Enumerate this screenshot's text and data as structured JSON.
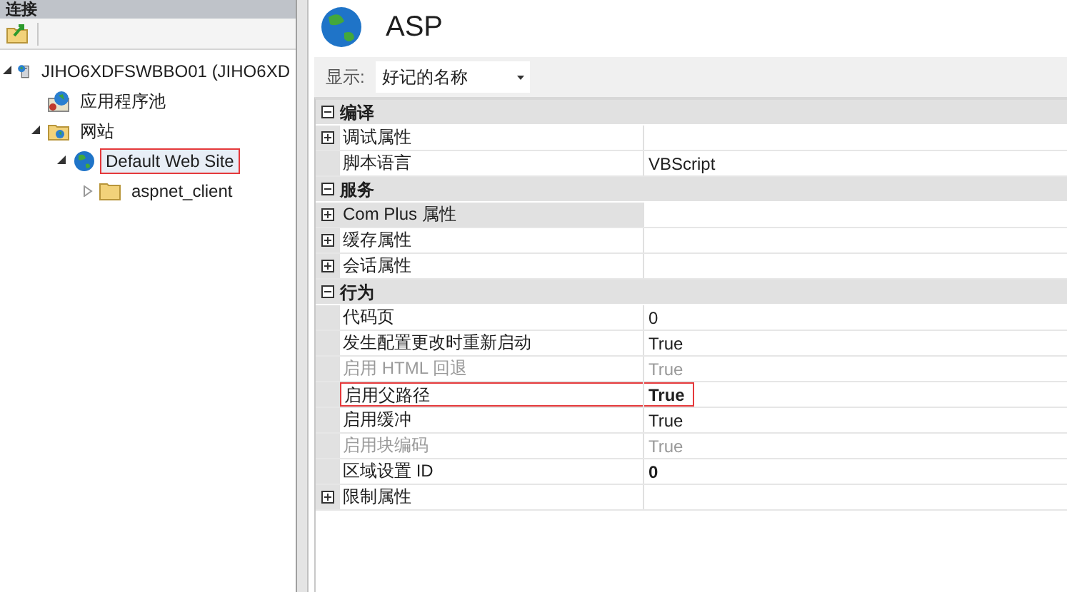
{
  "connections": {
    "title": "连接",
    "tree": [
      {
        "label": "JIHO6XDFSWBBO01 (JIHO6XD",
        "kind": "server",
        "expanded": true,
        "selected": false,
        "children": [
          {
            "label": "应用程序池",
            "kind": "pool",
            "selected": false
          },
          {
            "label": "网站",
            "kind": "sites",
            "expanded": true,
            "selected": false,
            "children": [
              {
                "label": "Default Web Site",
                "kind": "site",
                "expanded": true,
                "selected": true,
                "children": [
                  {
                    "label": "aspnet_client",
                    "kind": "folder",
                    "expanded": false,
                    "selected": false
                  }
                ]
              }
            ]
          }
        ]
      }
    ]
  },
  "header": {
    "title": "ASP"
  },
  "display": {
    "label": "显示:",
    "value": "好记的名称"
  },
  "properties": [
    {
      "kind": "category",
      "name": "编译",
      "expanded": true
    },
    {
      "kind": "property",
      "name": "调试属性",
      "expandable": true,
      "disabled": false,
      "selected": false,
      "highlighted": false
    },
    {
      "kind": "property",
      "name": "脚本语言",
      "value": "VBScript",
      "expandable": false,
      "disabled": false,
      "bold": false,
      "selected": false,
      "highlighted": false
    },
    {
      "kind": "category",
      "name": "服务",
      "expanded": true
    },
    {
      "kind": "property",
      "name": "Com Plus 属性",
      "expandable": true,
      "disabled": false,
      "selected": true,
      "highlighted": false
    },
    {
      "kind": "property",
      "name": "缓存属性",
      "expandable": true,
      "disabled": false,
      "selected": false,
      "highlighted": false
    },
    {
      "kind": "property",
      "name": "会话属性",
      "expandable": true,
      "disabled": false,
      "selected": false,
      "highlighted": false
    },
    {
      "kind": "category",
      "name": "行为",
      "expanded": true
    },
    {
      "kind": "property",
      "name": "代码页",
      "value": "0",
      "expandable": false,
      "disabled": false,
      "bold": false,
      "selected": false,
      "highlighted": false
    },
    {
      "kind": "property",
      "name": "发生配置更改时重新启动",
      "value": "True",
      "expandable": false,
      "disabled": false,
      "bold": false,
      "selected": false,
      "highlighted": false
    },
    {
      "kind": "property",
      "name": "启用 HTML 回退",
      "value": "True",
      "expandable": false,
      "disabled": true,
      "bold": false,
      "selected": false,
      "highlighted": false
    },
    {
      "kind": "property",
      "name": "启用父路径",
      "value": "True",
      "expandable": false,
      "disabled": false,
      "bold": true,
      "selected": false,
      "highlighted": true
    },
    {
      "kind": "property",
      "name": "启用缓冲",
      "value": "True",
      "expandable": false,
      "disabled": false,
      "bold": false,
      "selected": false,
      "highlighted": false
    },
    {
      "kind": "property",
      "name": "启用块编码",
      "value": "True",
      "expandable": false,
      "disabled": true,
      "bold": false,
      "selected": false,
      "highlighted": false
    },
    {
      "kind": "property",
      "name": "区域设置 ID",
      "value": "0",
      "expandable": false,
      "disabled": false,
      "bold": true,
      "selected": false,
      "highlighted": false
    },
    {
      "kind": "property",
      "name": "限制属性",
      "expandable": true,
      "disabled": false,
      "selected": false,
      "highlighted": false
    }
  ]
}
